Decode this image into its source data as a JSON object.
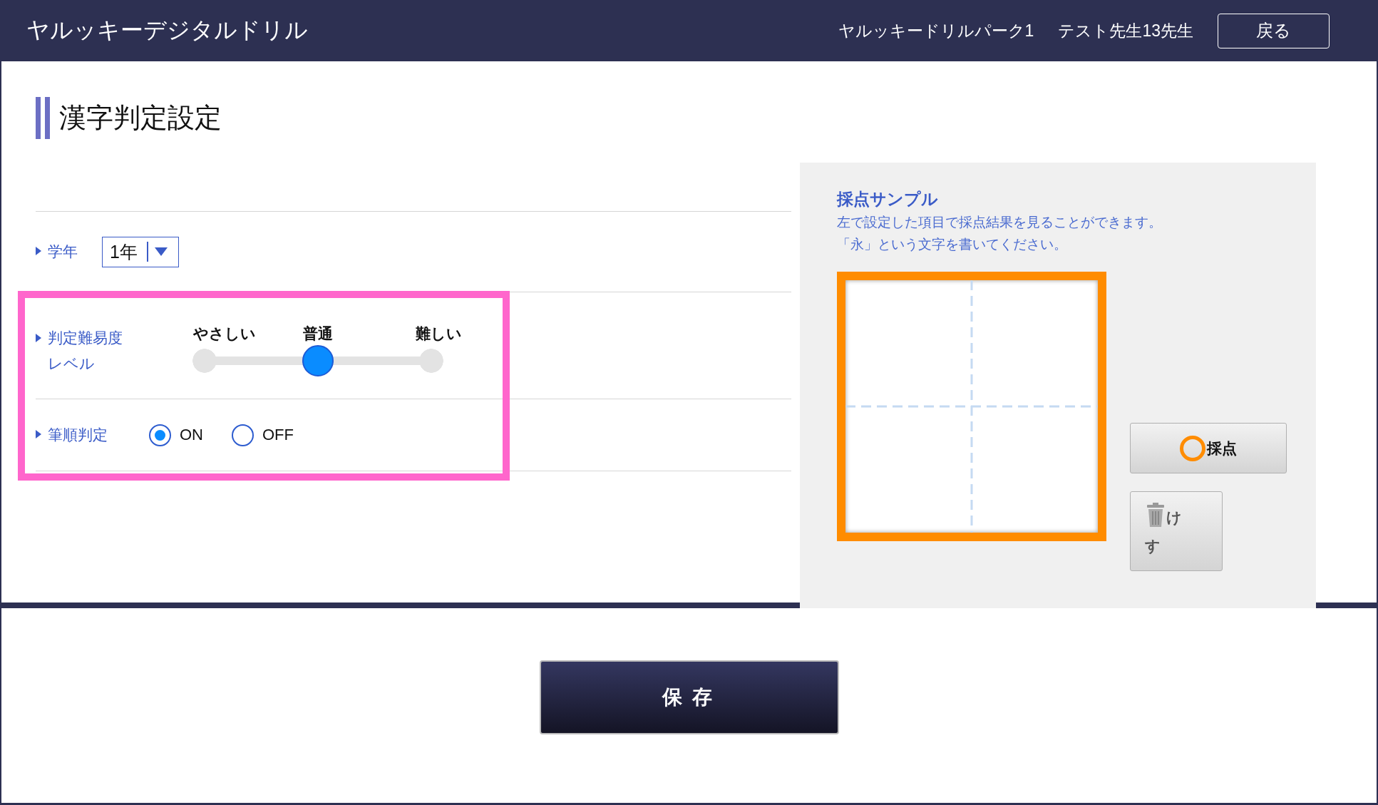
{
  "header": {
    "app_title": "ヤルッキーデジタルドリル",
    "school": "ヤルッキードリルパーク1",
    "user": "テスト先生13先生",
    "back_button": "戻る"
  },
  "page_title": "漢字判定設定",
  "settings": {
    "grade": {
      "label": "学年",
      "value": "1年"
    },
    "difficulty": {
      "label": "判定難易度レベル",
      "stops": [
        "やさしい",
        "普通",
        "難しい"
      ],
      "level": 0.5
    },
    "stroke_order": {
      "label": "筆順判定",
      "options": [
        {
          "label": "ON",
          "selected": true
        },
        {
          "label": "OFF",
          "selected": false
        }
      ]
    }
  },
  "sample": {
    "title": "採点サンプル",
    "description": [
      "左で設定した項目で採点結果を見ることができます。",
      "「永」という文字を書いてください。"
    ],
    "score_button": "採点",
    "clear_button": "けす"
  },
  "save_button": "保存"
}
